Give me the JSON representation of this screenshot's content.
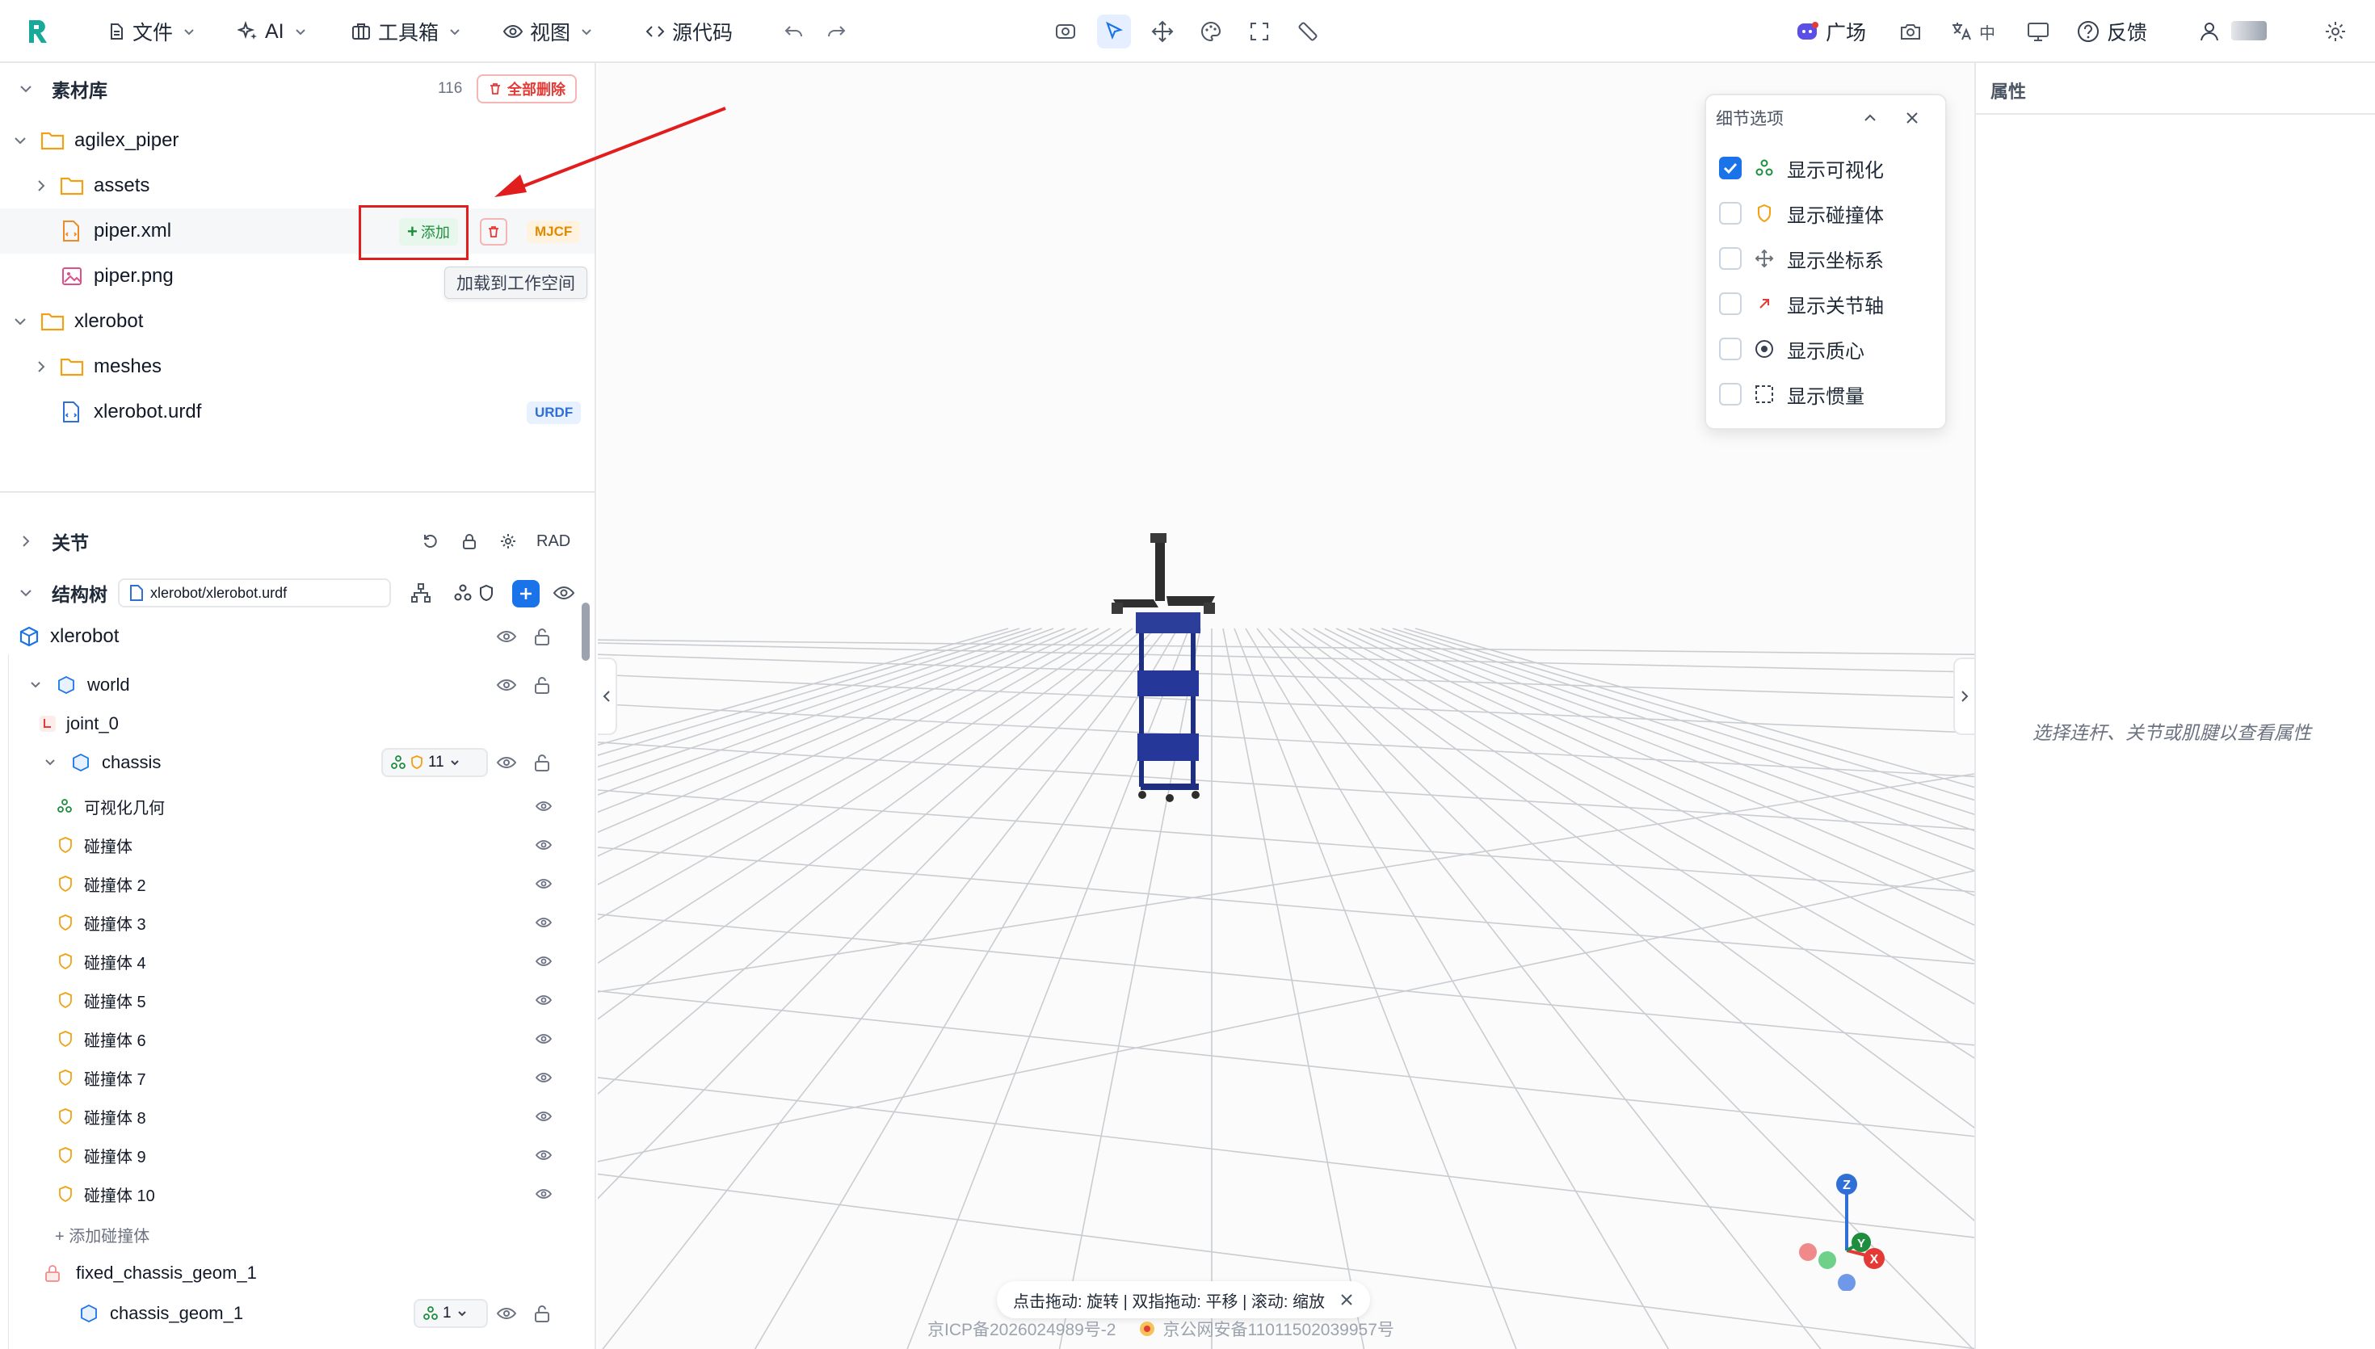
{
  "toolbar": {
    "file": "文件",
    "ai": "AI",
    "toolbox": "工具箱",
    "view": "视图",
    "source": "源代码",
    "plaza": "广场",
    "lang": "中",
    "feedback": "反馈"
  },
  "assets": {
    "title": "素材库",
    "count": "116",
    "delete_all": "全部删除",
    "tree": [
      {
        "label": "agilex_piper"
      },
      {
        "label": "assets"
      },
      {
        "label": "piper.xml",
        "tag": "MJCF",
        "add": "添加",
        "tooltip": "加载到工作空间"
      },
      {
        "label": "piper.png"
      },
      {
        "label": "xlerobot"
      },
      {
        "label": "meshes"
      },
      {
        "label": "xlerobot.urdf",
        "tag": "URDF"
      }
    ]
  },
  "joints": {
    "title": "关节",
    "unit": "RAD"
  },
  "structure": {
    "title": "结构树",
    "file": "xlerobot/xlerobot.urdf",
    "root": "xlerobot",
    "world": "world",
    "joint0": "joint_0",
    "chassis": "chassis",
    "chassis_count": "11",
    "visual": "可视化几何",
    "colliders": [
      "碰撞体",
      "碰撞体 2",
      "碰撞体 3",
      "碰撞体 4",
      "碰撞体 5",
      "碰撞体 6",
      "碰撞体 7",
      "碰撞体 8",
      "碰撞体 9",
      "碰撞体 10"
    ],
    "add_collider": "+ 添加碰撞体",
    "fixed_joint": "fixed_chassis_geom_1",
    "geom": "chassis_geom_1",
    "geom_count": "1"
  },
  "detail_options": {
    "title": "细节选项",
    "items": [
      {
        "label": "显示可视化",
        "checked": true
      },
      {
        "label": "显示碰撞体",
        "checked": false
      },
      {
        "label": "显示坐标系",
        "checked": false
      },
      {
        "label": "显示关节轴",
        "checked": false
      },
      {
        "label": "显示质心",
        "checked": false
      },
      {
        "label": "显示惯量",
        "checked": false
      }
    ]
  },
  "properties": {
    "title": "属性",
    "empty_hint": "选择连杆、关节或肌腱以查看属性"
  },
  "viewport": {
    "hint": "点击拖动: 旋转 | 双指拖动: 平移 | 滚动: 缩放",
    "icp": "京ICP备2026024989号-2",
    "police": "京公网安备11011502039957号"
  },
  "colors": {
    "accent": "#1a73e8",
    "danger": "#e53935",
    "annotation": "#e11d1d"
  }
}
